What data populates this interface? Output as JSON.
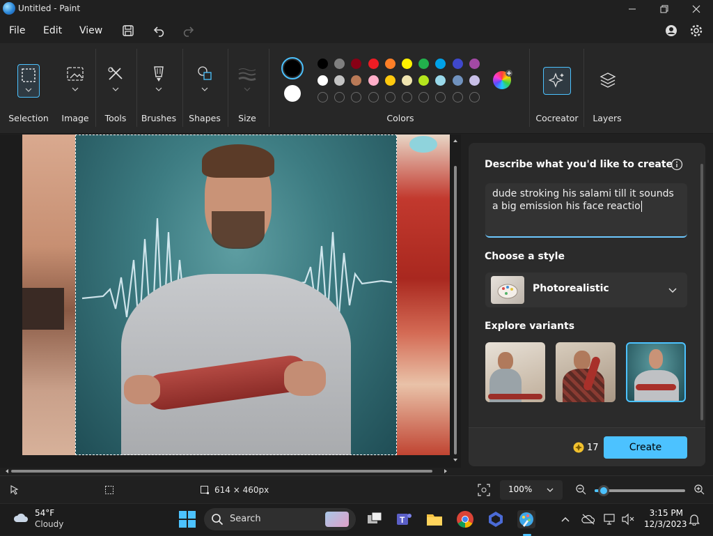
{
  "window": {
    "title": "Untitled - Paint"
  },
  "menu": {
    "file": "File",
    "edit": "Edit",
    "view": "View"
  },
  "ribbon": {
    "selection": "Selection",
    "image": "Image",
    "tools": "Tools",
    "brushes": "Brushes",
    "shapes": "Shapes",
    "size": "Size",
    "colors": "Colors",
    "cocreator": "Cocreator",
    "layers": "Layers"
  },
  "palette": {
    "row1": [
      "#000000",
      "#7f7f7f",
      "#880015",
      "#ed1c24",
      "#ff7f27",
      "#fff200",
      "#22b14c",
      "#00a2e8",
      "#3f48cc",
      "#a349a4"
    ],
    "row2": [
      "#ffffff",
      "#c3c3c3",
      "#b97a57",
      "#ffaec9",
      "#ffc90e",
      "#efe4b0",
      "#b5e61d",
      "#99d9ea",
      "#7092be",
      "#c8bfe7"
    ]
  },
  "cocreator": {
    "heading": "Describe what you'd like to create",
    "prompt": "dude stroking his salami till it sounds a big emission his face reactio",
    "style_heading": "Choose a style",
    "style_value": "Photorealistic",
    "variants_heading": "Explore variants",
    "credits": "17",
    "create_label": "Create"
  },
  "status": {
    "dimensions": "614 × 460px",
    "zoom": "100%",
    "zoom_level": 0.1
  },
  "taskbar": {
    "temperature": "54°F",
    "weather": "Cloudy",
    "search": "Search",
    "time": "3:15 PM",
    "date": "12/3/2023"
  }
}
